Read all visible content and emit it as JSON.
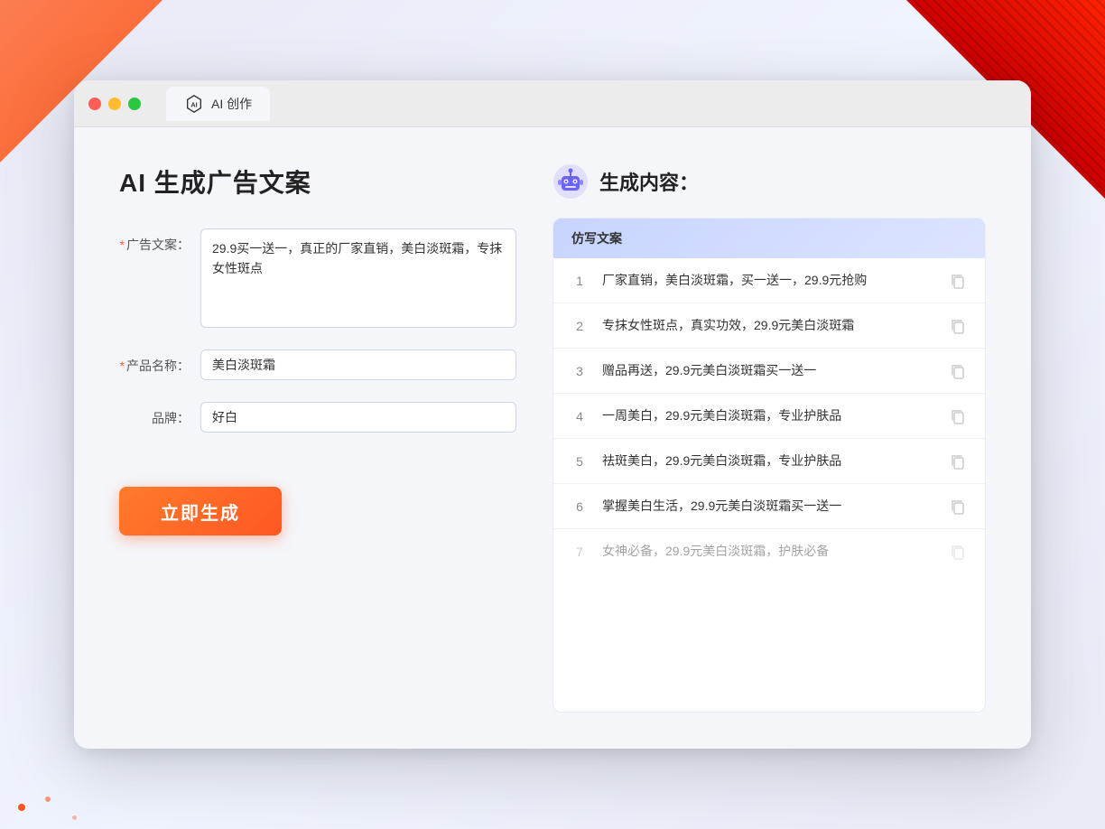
{
  "browser": {
    "tab_title": "AI 创作"
  },
  "page": {
    "title": "AI 生成广告文案"
  },
  "form": {
    "ad_label": "广告文案：",
    "ad_required": "*",
    "ad_value": "29.9买一送一，真正的厂家直销，美白淡斑霜，专抹女性斑点",
    "product_label": "产品名称：",
    "product_required": "*",
    "product_value": "美白淡斑霜",
    "brand_label": "品牌：",
    "brand_value": "好白",
    "generate_btn": "立即生成"
  },
  "result": {
    "title": "生成内容：",
    "column_header": "仿写文案",
    "items": [
      {
        "num": "1",
        "text": "厂家直销，美白淡斑霜，买一送一，29.9元抢购",
        "dimmed": false
      },
      {
        "num": "2",
        "text": "专抹女性斑点，真实功效，29.9元美白淡斑霜",
        "dimmed": false
      },
      {
        "num": "3",
        "text": "赠品再送，29.9元美白淡斑霜买一送一",
        "dimmed": false
      },
      {
        "num": "4",
        "text": "一周美白，29.9元美白淡斑霜，专业护肤品",
        "dimmed": false
      },
      {
        "num": "5",
        "text": "祛斑美白，29.9元美白淡斑霜，专业护肤品",
        "dimmed": false
      },
      {
        "num": "6",
        "text": "掌握美白生活，29.9元美白淡斑霜买一送一",
        "dimmed": false
      },
      {
        "num": "7",
        "text": "女神必备，29.9元美白淡斑霜，护肤必备",
        "dimmed": true
      }
    ]
  }
}
